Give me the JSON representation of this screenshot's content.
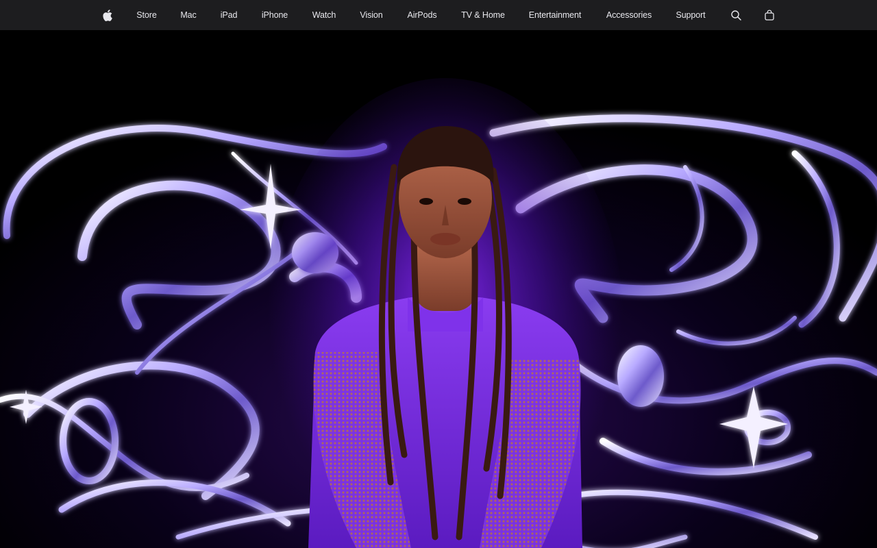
{
  "nav": {
    "items": [
      {
        "label": "Store"
      },
      {
        "label": "Mac"
      },
      {
        "label": "iPad"
      },
      {
        "label": "iPhone"
      },
      {
        "label": "Watch"
      },
      {
        "label": "Vision"
      },
      {
        "label": "AirPods"
      },
      {
        "label": "TV & Home"
      },
      {
        "label": "Entertainment"
      },
      {
        "label": "Accessories"
      },
      {
        "label": "Support"
      }
    ],
    "icons": {
      "logo": "apple-logo-icon",
      "search": "search-icon",
      "bag": "shopping-bag-icon"
    }
  },
  "colors": {
    "nav_bg": "#1d1d1f",
    "nav_text": "#e8e8ed",
    "hero_bg": "#000000",
    "chrome": "#c9c2ff",
    "accent_purple": "#7b2fe0"
  }
}
